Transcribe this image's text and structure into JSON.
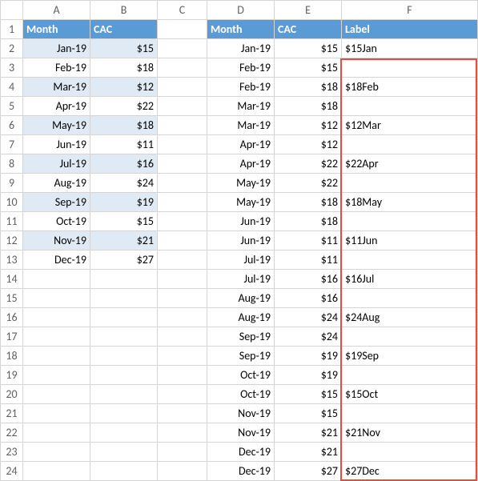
{
  "columns": [
    "",
    "A",
    "B",
    "C",
    "D",
    "E",
    "F"
  ],
  "header1": {
    "A": "Month",
    "B": "CAC"
  },
  "header2": {
    "D": "Month",
    "E": "CAC",
    "F": "Label"
  },
  "left_data": [
    {
      "month": "Jan-19",
      "cac": "$15"
    },
    {
      "month": "Feb-19",
      "cac": "$18"
    },
    {
      "month": "Mar-19",
      "cac": "$12"
    },
    {
      "month": "Apr-19",
      "cac": "$22"
    },
    {
      "month": "May-19",
      "cac": "$18"
    },
    {
      "month": "Jun-19",
      "cac": "$11"
    },
    {
      "month": "Jul-19",
      "cac": "$16"
    },
    {
      "month": "Aug-19",
      "cac": "$24"
    },
    {
      "month": "Sep-19",
      "cac": "$19"
    },
    {
      "month": "Oct-19",
      "cac": "$15"
    },
    {
      "month": "Nov-19",
      "cac": "$21"
    },
    {
      "month": "Dec-19",
      "cac": "$27"
    }
  ],
  "right_data": [
    {
      "month": "Jan-19",
      "cac": "$15",
      "label": "$15Jan"
    },
    {
      "month": "Feb-19",
      "cac": "$15",
      "label": ""
    },
    {
      "month": "Feb-19",
      "cac": "$18",
      "label": "$18Feb"
    },
    {
      "month": "Mar-19",
      "cac": "$18",
      "label": ""
    },
    {
      "month": "Mar-19",
      "cac": "$12",
      "label": "$12Mar"
    },
    {
      "month": "Apr-19",
      "cac": "$12",
      "label": ""
    },
    {
      "month": "Apr-19",
      "cac": "$22",
      "label": "$22Apr"
    },
    {
      "month": "May-19",
      "cac": "$22",
      "label": ""
    },
    {
      "month": "May-19",
      "cac": "$18",
      "label": "$18May"
    },
    {
      "month": "Jun-19",
      "cac": "$18",
      "label": ""
    },
    {
      "month": "Jun-19",
      "cac": "$11",
      "label": "$11Jun"
    },
    {
      "month": "Jul-19",
      "cac": "$11",
      "label": ""
    },
    {
      "month": "Jul-19",
      "cac": "$16",
      "label": "$16Jul"
    },
    {
      "month": "Aug-19",
      "cac": "$16",
      "label": ""
    },
    {
      "month": "Aug-19",
      "cac": "$24",
      "label": "$24Aug"
    },
    {
      "month": "Sep-19",
      "cac": "$24",
      "label": ""
    },
    {
      "month": "Sep-19",
      "cac": "$19",
      "label": "$19Sep"
    },
    {
      "month": "Oct-19",
      "cac": "$19",
      "label": ""
    },
    {
      "month": "Oct-19",
      "cac": "$15",
      "label": "$15Oct"
    },
    {
      "month": "Nov-19",
      "cac": "$15",
      "label": ""
    },
    {
      "month": "Nov-19",
      "cac": "$21",
      "label": "$21Nov"
    },
    {
      "month": "Dec-19",
      "cac": "$21",
      "label": ""
    },
    {
      "month": "Dec-19",
      "cac": "$27",
      "label": "$27Dec"
    }
  ],
  "rows": [
    "1",
    "2",
    "3",
    "4",
    "5",
    "6",
    "7",
    "8",
    "9",
    "10",
    "11",
    "12",
    "13",
    "14",
    "15",
    "16",
    "17",
    "18",
    "19",
    "20",
    "21",
    "22",
    "23",
    "24"
  ]
}
